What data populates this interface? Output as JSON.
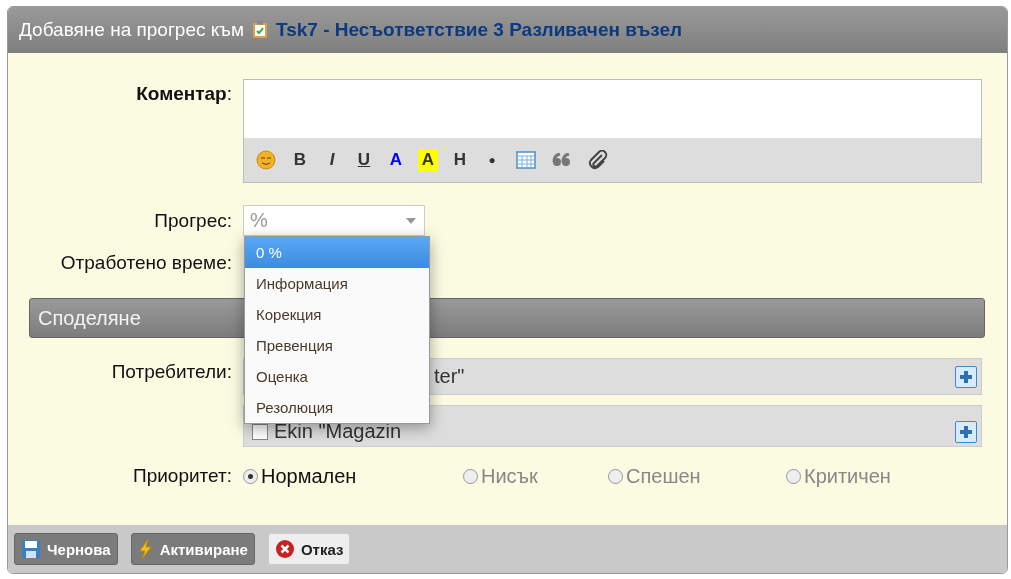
{
  "window": {
    "title": "Добавяне на прогрес към",
    "task": "Tsk7 - Несъответствие 3 Разливачен възел"
  },
  "comment": {
    "label": "Коментар",
    "colon": ":"
  },
  "toolbar": [
    {
      "kind": "emoji"
    },
    {
      "kind": "bold",
      "label": "B"
    },
    {
      "kind": "italic",
      "label": "I"
    },
    {
      "kind": "underline",
      "label": "U"
    },
    {
      "kind": "color",
      "label": "A"
    },
    {
      "kind": "highlight",
      "label": "A"
    },
    {
      "kind": "heading",
      "label": "H"
    },
    {
      "kind": "bullet",
      "label": "●"
    },
    {
      "kind": "table"
    },
    {
      "kind": "quote"
    },
    {
      "kind": "attach"
    }
  ],
  "progress": {
    "label": "Прогрес:",
    "placeholder": "%",
    "options": [
      {
        "label": "0 %",
        "selected": true
      },
      {
        "label": "Информация",
        "selected": false
      },
      {
        "label": "Корекция",
        "selected": false
      },
      {
        "label": "Превенция",
        "selected": false
      },
      {
        "label": "Оценка",
        "selected": false
      },
      {
        "label": "Резолюция",
        "selected": false
      }
    ]
  },
  "worked_time": {
    "label": "Отработено време:"
  },
  "sharing": {
    "title": "Споделяне"
  },
  "users": {
    "label": "Потребители:",
    "rows": [
      {
        "kind": "covered",
        "text": "ter\""
      },
      {
        "kind": "checkbox",
        "text": "Ekin \"Magazin",
        "checked": false
      }
    ]
  },
  "priority": {
    "label": "Приоритет:",
    "options": [
      {
        "label": "Нормален",
        "selected": true
      },
      {
        "label": "Нисък",
        "selected": false
      },
      {
        "label": "Спешен",
        "selected": false
      },
      {
        "label": "Критичен",
        "selected": false
      }
    ]
  },
  "buttons": [
    {
      "kind": "draft",
      "label": "Чернова"
    },
    {
      "kind": "activate",
      "label": "Активиране"
    },
    {
      "kind": "cancel",
      "label": "Отказ"
    }
  ]
}
